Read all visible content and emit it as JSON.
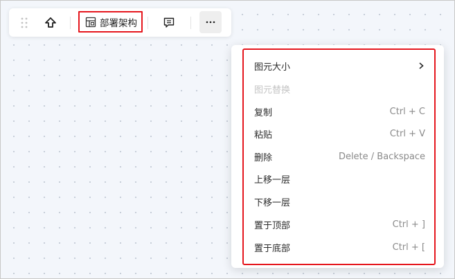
{
  "toolbar": {
    "org_chart_label": "部署架构"
  },
  "context_menu": {
    "items": [
      {
        "label": "图元大小",
        "shortcut": "",
        "submenu": true
      },
      {
        "label": "图元替换",
        "shortcut": "",
        "disabled": true
      },
      {
        "label": "复制",
        "shortcut": "Ctrl + C"
      },
      {
        "label": "粘贴",
        "shortcut": "Ctrl + V"
      },
      {
        "label": "删除",
        "shortcut": "Delete / Backspace"
      },
      {
        "label": "上移一层",
        "shortcut": ""
      },
      {
        "label": "下移一层",
        "shortcut": ""
      },
      {
        "label": "置于顶部",
        "shortcut": "Ctrl + ]"
      },
      {
        "label": "置于底部",
        "shortcut": "Ctrl + ["
      }
    ]
  },
  "colors": {
    "highlight": "#e5161d",
    "canvas": "#f3f6fb",
    "disabled_text": "#c4c4c4"
  },
  "icons": [
    "drag-handle-icon",
    "arrow-up-icon",
    "org-layout-icon",
    "comment-icon",
    "more-icon",
    "chevron-right-icon"
  ]
}
